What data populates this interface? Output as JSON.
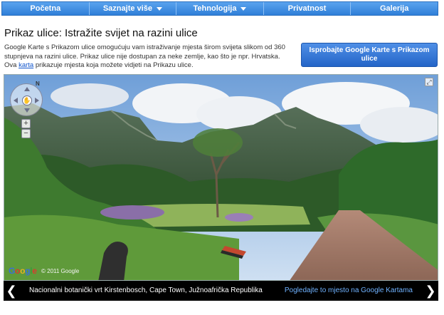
{
  "nav": {
    "items": [
      {
        "label": "Početna",
        "dropdown": false
      },
      {
        "label": "Saznajte više",
        "dropdown": true
      },
      {
        "label": "Tehnologija",
        "dropdown": true
      },
      {
        "label": "Privatnost",
        "dropdown": false
      },
      {
        "label": "Galerija",
        "dropdown": false
      }
    ]
  },
  "main": {
    "title": "Prikaz ulice: Istražite svijet na razini ulice",
    "intro_before_link": "Google Karte s Prikazom ulice omogućuju vam istraživanje mjesta širom svijeta slikom od 360 stupnjeva na razini ulice. Prikaz ulice nije dostupan za neke zemlje, kao što je npr. Hrvatska. Ova ",
    "intro_link": "karta",
    "intro_after_link": " prikazuje mjesta koja možete vidjeti na Prikazu ulice.",
    "cta_label": "Isprobajte Google Karte s Prikazom ulice"
  },
  "viewer": {
    "compass_north": "N",
    "zoom_in": "+",
    "zoom_out": "−",
    "fullscreen": "⤢",
    "logo": [
      "G",
      "o",
      "o",
      "g",
      "l",
      "e"
    ],
    "copyright": "© 2011 Google"
  },
  "caption": {
    "prev": "❮",
    "next": "❯",
    "location": "Nacionalni botanički vrt Kirstenbosch, Cape Town, Južnoafrička Republika",
    "link": "Pogledajte to mjesto na Google Kartama"
  },
  "colors": {
    "nav_bg": "#3a89e0",
    "cta_bg": "#2f74d6",
    "link": "#1155cc",
    "caption_link": "#6fb2ff"
  }
}
